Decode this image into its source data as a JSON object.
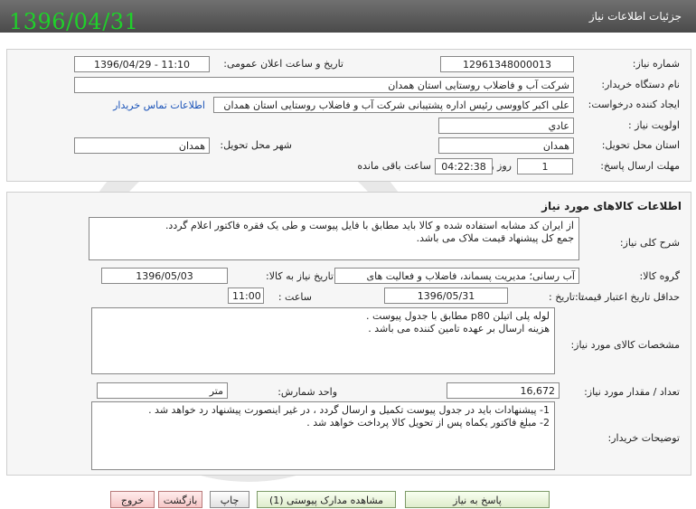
{
  "header": {
    "title": "جزئیات اطلاعات نیاز",
    "stamp_date": "1396/04/31"
  },
  "need_info": {
    "need_number_label": "شماره نیاز:",
    "need_number": "1296134800001З",
    "announce_label": "تاریخ و ساعت اعلان عمومی:",
    "announce_value": "1396/04/29 - 11:10",
    "buyer_org_label": "نام دستگاه خریدار:",
    "buyer_org": "شرکت آب و فاضلاب روستایی استان همدان",
    "requester_label": "ایجاد کننده درخواست:",
    "requester": "علی اکبر کاووسی رئیس اداره پشتیبانی شرکت آب و فاضلاب روستایی استان همدان",
    "contact_link": "اطلاعات تماس خریدار",
    "priority_label": "اولویت نیاز :",
    "priority": "عادي",
    "province_label": "استان محل تحویل:",
    "province": "همدان",
    "city_label": "شهر محل تحویل:",
    "city": "همدان",
    "deadline_label": "مهلت ارسال پاسخ:",
    "deadline_days": "1",
    "days_label": "روز و",
    "deadline_time": "04:22:38",
    "remaining_label": "ساعت باقی مانده"
  },
  "goods": {
    "section_title": "اطلاعات کالاهای مورد نیاز",
    "general_desc_label": "شرح کلی نیاز:",
    "general_desc": "از ایران کد مشابه استفاده شده و کالا باید مطابق با فایل پیوست و طی یک فقره فاکتور اعلام گردد.\nجمع کل پیشنهاد قیمت ملاک می باشد.",
    "group_label": "گروه کالا:",
    "group_value": "آب رسانی؛ مدیریت پسماند، فاضلاب و فعالیت های",
    "need_date_label": "تاریخ نیاز به کالا:",
    "need_date": "1396/05/03",
    "min_price_label": "حداقل تاریخ اعتبار قیمت:",
    "until_date_label": "تا تاریخ :",
    "until_date": "1396/05/31",
    "time_label": "ساعت :",
    "time_value": "11:00",
    "specs_label": "مشخصات کالای مورد نیاز:",
    "specs": "لوله پلی اتیلن p80 مطابق با جدول پیوست .\nهزینه ارسال بر عهده تامین کننده می باشد .",
    "qty_label": "تعداد / مقدار مورد نیاز:",
    "qty": "16,672",
    "unit_label": "واحد شمارش:",
    "unit": "متر",
    "buyer_notes_label": "توضیحات خریدار:",
    "buyer_notes": "1- پیشنهادات باید در جدول پیوست تکمیل و ارسال گردد ، در غیر اینصورت پیشنهاد رد خواهد شد .\n2- مبلغ فاکتور یکماه پس از تحویل کالا پرداخت خواهد شد ."
  },
  "buttons": {
    "reply": "پاسخ به نیاز",
    "attachments": "مشاهده مدارک پیوستی (1)",
    "print": "چاپ",
    "back": "بازگشت",
    "exit": "خروج"
  }
}
